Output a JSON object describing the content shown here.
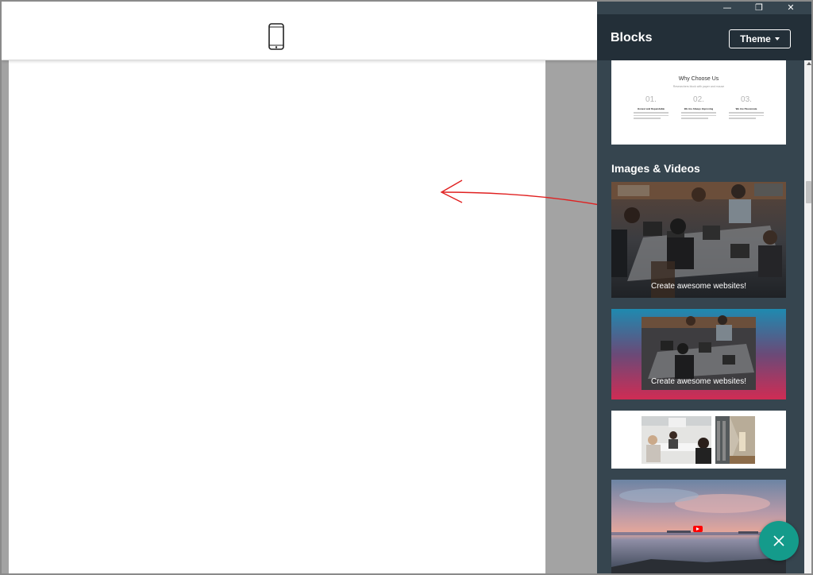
{
  "window": {
    "minimize_glyph": "—",
    "restore_glyph": "❐",
    "close_glyph": "✕"
  },
  "topbar": {
    "device_icon": "mobile-phone-icon"
  },
  "sidebar": {
    "title": "Blocks",
    "theme_button": "Theme",
    "section_images_videos": "Images & Videos",
    "why_card": {
      "title": "Why Choose Us",
      "subtitle": "Researchers block with paper and mouse",
      "columns": [
        {
          "num": "01.",
          "heading": "Honest and Dependable"
        },
        {
          "num": "02.",
          "heading": "We Are Always Improving"
        },
        {
          "num": "03.",
          "heading": "We Are Passionate"
        }
      ]
    },
    "block_captions": {
      "image1": "Create awesome websites!",
      "image2": "Create awesome websites!"
    }
  },
  "colors": {
    "sidebar_bg": "#36454f",
    "sidebar_header": "#232f38",
    "fab": "#149b8b",
    "annotation": "#e02020"
  },
  "fab": {
    "icon": "close-icon"
  }
}
